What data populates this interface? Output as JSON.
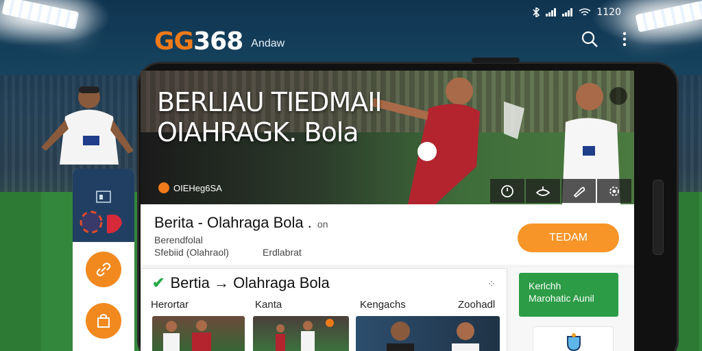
{
  "status": {
    "icons": [
      "bluetooth-icon",
      "signal-icon",
      "signal-icon",
      "wifi-icon"
    ],
    "time": "1120"
  },
  "app": {
    "logo_gg": "GG",
    "logo_num": "368",
    "subtitle": "Andaw"
  },
  "hero": {
    "title_line1": "BERLIAU TIEDMAII",
    "title_line2": "OIAHRAGK. Bola",
    "brand": "OIEHeg6SA",
    "tools": [
      "clock-icon",
      "ball-icon",
      "whistle-icon",
      "settings-icon"
    ]
  },
  "info": {
    "title": "Berita - Olahraga Bola .",
    "title_small": "on",
    "sub1": "Berendfolal",
    "sub2": "Sfebiid (Olahraol)",
    "sub3": "Erdlabrat",
    "team_button": "TEDAM"
  },
  "news": {
    "title": "Bertia → Olahraga Bola",
    "columns": [
      "Herortar",
      "Kanta",
      "Kengachs",
      "Zoohadl"
    ]
  },
  "promo": {
    "line1": "Kerlchh",
    "line2": "Marohatic Aunil"
  },
  "colors": {
    "accent_orange": "#f79528",
    "brand_orange": "#f07a1a",
    "green": "#2c9c46",
    "rail_blue": "#213f63"
  }
}
